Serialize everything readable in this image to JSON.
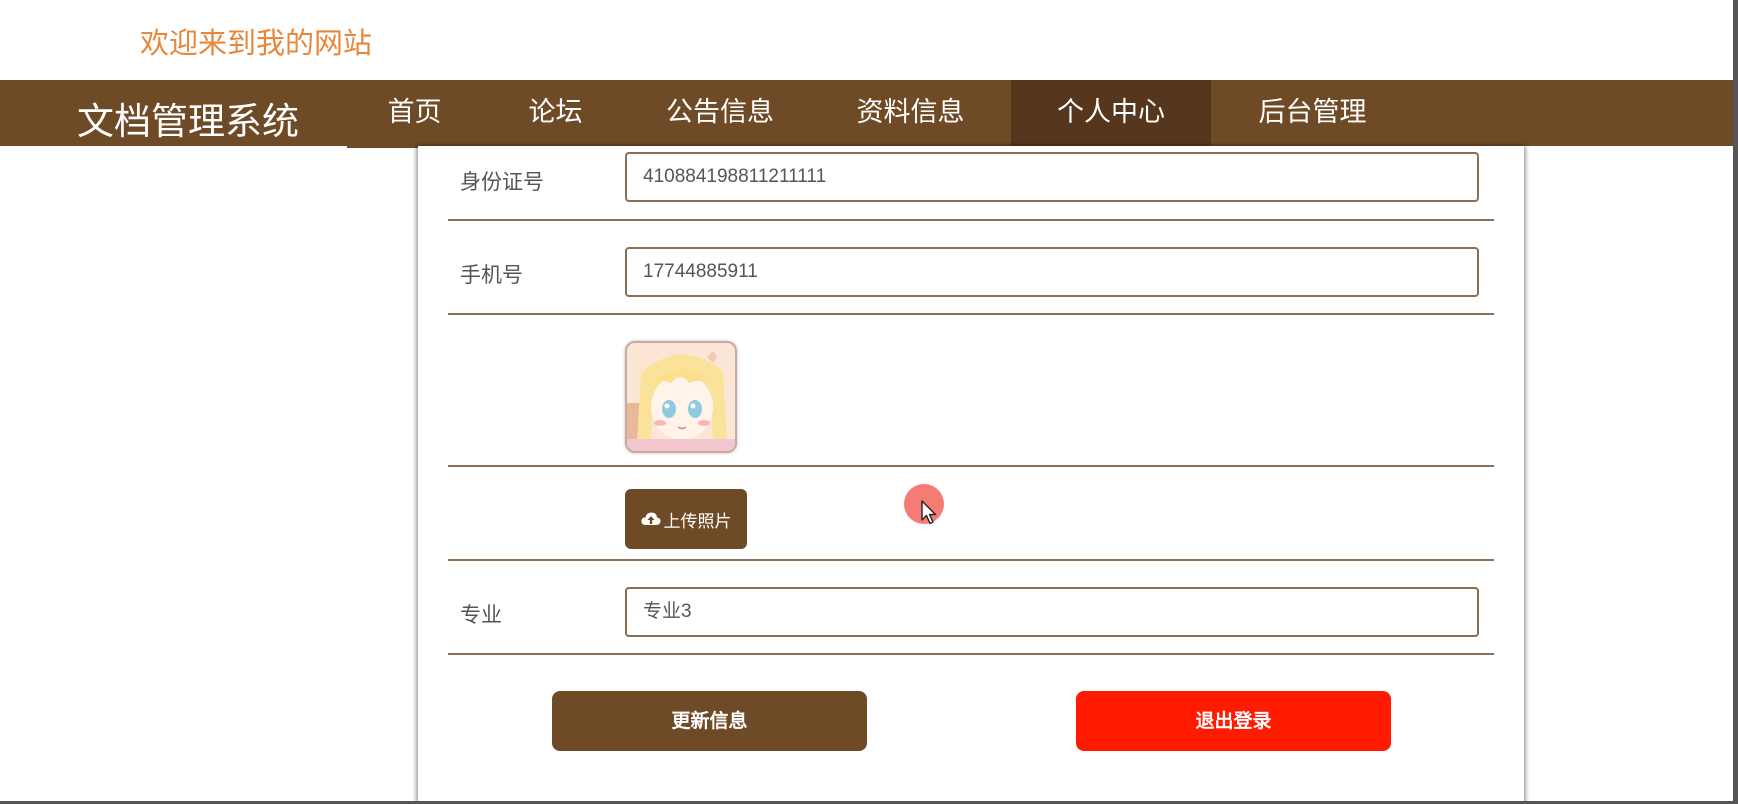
{
  "header": {
    "welcome_text": "欢迎来到我的网站"
  },
  "navbar": {
    "brand": "文档管理系统",
    "items": [
      {
        "label": "首页",
        "active": false
      },
      {
        "label": "论坛",
        "active": false
      },
      {
        "label": "公告信息",
        "active": false
      },
      {
        "label": "资料信息",
        "active": false
      },
      {
        "label": "个人中心",
        "active": true
      },
      {
        "label": "后台管理",
        "active": false
      }
    ]
  },
  "profile_form": {
    "id_number": {
      "label": "身份证号",
      "value": "410884198811211111"
    },
    "phone": {
      "label": "手机号",
      "value": "17744885911"
    },
    "avatar": {
      "icon": "anime-girl-avatar-image"
    },
    "upload": {
      "label": "上传照片",
      "icon": "cloud-upload-icon"
    },
    "major": {
      "label": "专业",
      "value": "专业3"
    },
    "update_button": "更新信息",
    "logout_button": "退出登录"
  },
  "colors": {
    "brand_brown": "#6e4a26",
    "active_nav": "#56371d",
    "welcome_orange": "#e8873a",
    "logout_red": "#ff1a00"
  }
}
